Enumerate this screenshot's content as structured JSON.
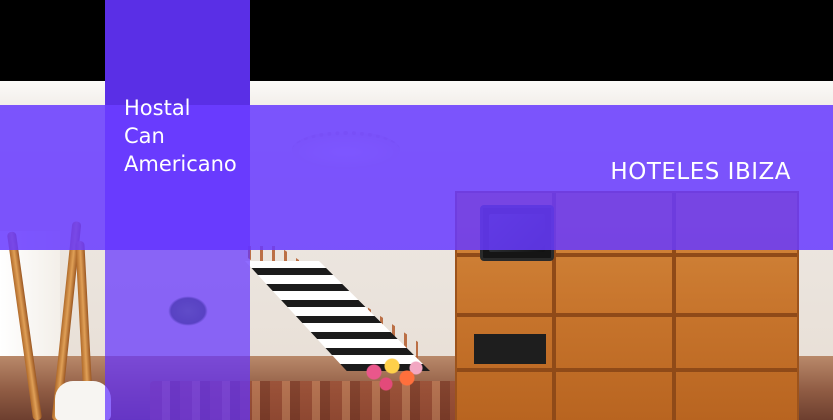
{
  "hotel": {
    "name": "Hostal\nCan\nAmericano"
  },
  "category": {
    "label": "HOTELES IBIZA"
  },
  "colors": {
    "overlay_purple": "#6a3aff",
    "column_purple": "#5a2fe6",
    "top_bar": "#000000",
    "text": "#ffffff"
  }
}
